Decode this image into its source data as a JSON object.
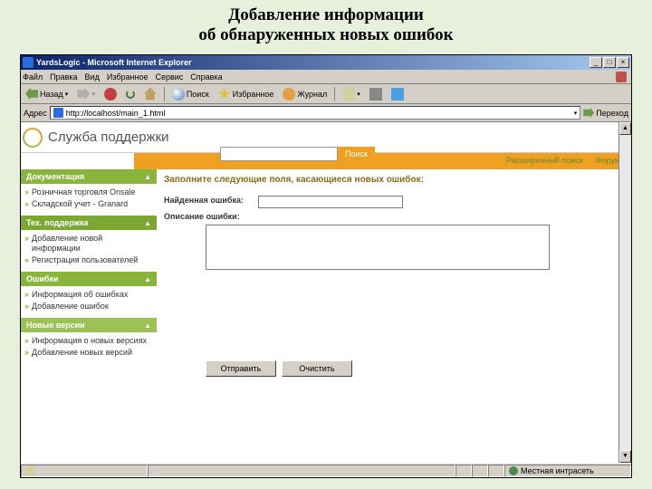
{
  "slide": {
    "title_line1": "Добавление информации",
    "title_line2": "об обнаруженных новых ошибок"
  },
  "titlebar": {
    "text": "YardsLogic - Microsoft Internet Explorer"
  },
  "menu": {
    "file": "Файл",
    "edit": "Правка",
    "view": "Вид",
    "favorites": "Избранное",
    "tools": "Сервис",
    "help": "Справка"
  },
  "toolbar": {
    "back": "Назад",
    "search": "Поиск",
    "favorites": "Избранное",
    "history": "Журнал"
  },
  "address": {
    "label": "Адрес",
    "url": "http://localhost/main_1.html",
    "goto": "Переход"
  },
  "page": {
    "title": "Служба поддержки",
    "search_btn": "Поиск",
    "adv_search": "Расширенный поиск",
    "forum": "Форум"
  },
  "sidebar": {
    "hdr1": "Документация",
    "items1": [
      {
        "label": "Розничная торговля Onsale"
      },
      {
        "label": "Складской учет - Granard"
      }
    ],
    "hdr2": "Тех. поддержка",
    "items2": [
      {
        "label": "Добавление новой информации"
      },
      {
        "label": "Регистрация пользователей"
      }
    ],
    "hdr3": "Ошибки",
    "items3": [
      {
        "label": "Информация об ошибках"
      },
      {
        "label": "Добавление ошибок"
      }
    ],
    "hdr4": "Новые версии",
    "items4": [
      {
        "label": "Информация о новых версиях"
      },
      {
        "label": "Добавление новых версий"
      }
    ]
  },
  "main": {
    "heading": "Заполните следующие поля, касающиеся новых ошибок:",
    "found_error": "Найденная ошибка:",
    "desc": "Описание ошибки:",
    "submit": "Отправить",
    "clear": "Очистить"
  },
  "status": {
    "left": "",
    "right": "Местная интрасеть"
  }
}
